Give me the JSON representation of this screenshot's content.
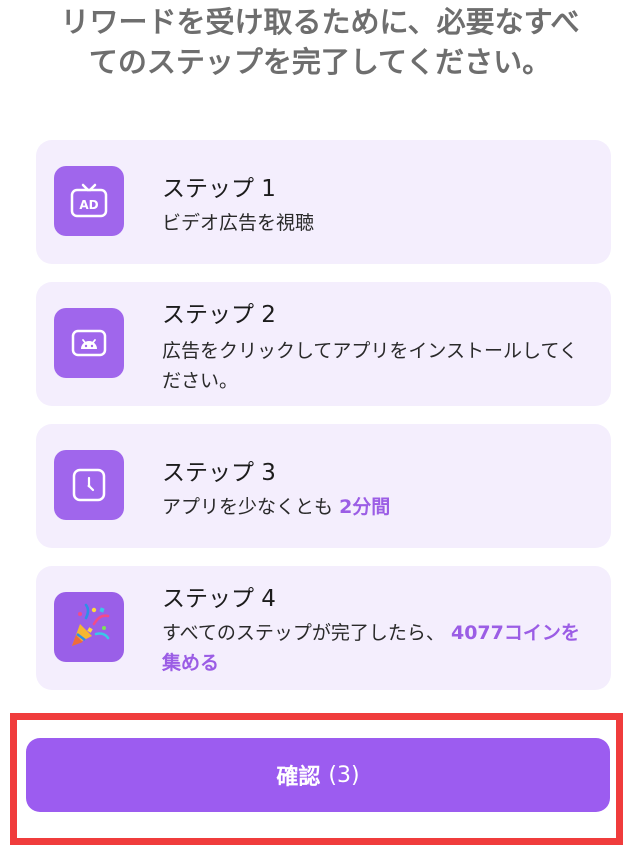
{
  "header": {
    "title": "リワードを受け取るために、必要なすべてのステップを完了してください。"
  },
  "steps": [
    {
      "title": "ステップ 1",
      "icon": "ad-tv-icon",
      "desc": "ビデオ広告を視聴"
    },
    {
      "title": "ステップ 2",
      "icon": "android-icon",
      "desc": "広告をクリックしてアプリをインストールしてください。"
    },
    {
      "title": "ステップ 3",
      "icon": "clock-icon",
      "desc_prefix": "アプリを少なくとも",
      "desc_highlight": "2分間"
    },
    {
      "title": "ステップ 4",
      "icon": "party-popper-icon",
      "desc_prefix": "すべてのステップが完了したら、",
      "desc_highlight": "4077コインを集める"
    }
  ],
  "confirm": {
    "label": "確認",
    "count": "(3)"
  },
  "colors": {
    "accent": "#9c5cf0",
    "card_bg": "#f4eefd",
    "highlight_frame": "#f03c3c"
  }
}
